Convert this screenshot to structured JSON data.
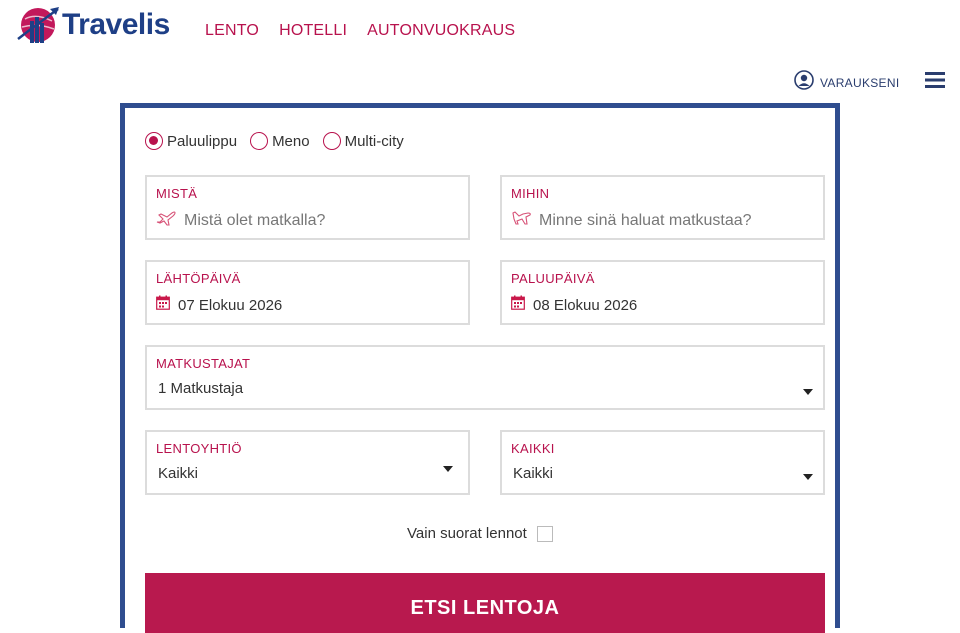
{
  "brand": {
    "name": "Travelis",
    "primary_color": "#b8124d",
    "navy_color": "#1e3f86"
  },
  "nav": {
    "items": [
      "LENTO",
      "HOTELLI",
      "AUTONVUOKRAUS"
    ]
  },
  "header": {
    "account_label": "VARAUKSENI",
    "account_icon": "user-circle-icon",
    "menu_icon": "hamburger-menu-icon"
  },
  "search_form": {
    "trip_types": [
      {
        "label": "Paluulippu",
        "selected": true
      },
      {
        "label": "Meno",
        "selected": false
      },
      {
        "label": "Multi-city",
        "selected": false
      }
    ],
    "from": {
      "label": "MISTÄ",
      "placeholder": "Mistä olet matkalla?",
      "icon": "plane-takeoff-icon"
    },
    "to": {
      "label": "MIHIN",
      "placeholder": "Minne sinä haluat matkustaa?",
      "icon": "plane-landing-icon"
    },
    "departure": {
      "label": "LÄHTÖPÄIVÄ",
      "value": "07 Elokuu 2026",
      "icon": "calendar-icon"
    },
    "return": {
      "label": "PALUUPÄIVÄ",
      "value": "08 Elokuu 2026",
      "icon": "calendar-icon"
    },
    "travelers": {
      "label": "MATKUSTAJAT",
      "value": "1 Matkustaja"
    },
    "airline": {
      "label": "LENTOYHTIÖ",
      "value": "Kaikki"
    },
    "class": {
      "label": "KAIKKI",
      "value": "Kaikki"
    },
    "direct_only": {
      "label": "Vain suorat lennot",
      "checked": false
    },
    "submit_label": "ETSI LENTOJA"
  }
}
